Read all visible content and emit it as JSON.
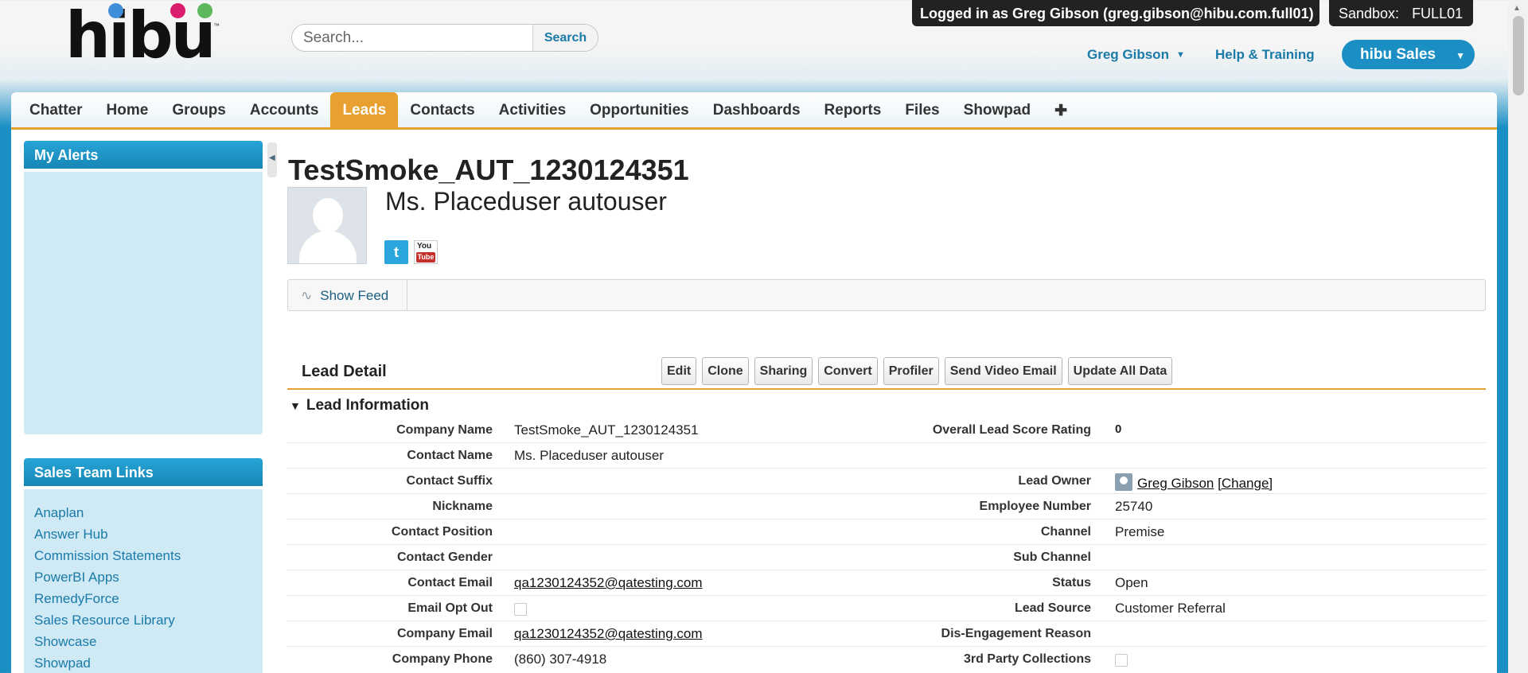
{
  "header": {
    "logo_text": "hibu",
    "logo_tm": "™",
    "search_placeholder": "Search...",
    "search_button": "Search",
    "login_badge": "Logged in as Greg Gibson (greg.gibson@hibu.com.full01)",
    "sandbox_label": "Sandbox:",
    "sandbox_value": "FULL01",
    "user_name": "Greg Gibson",
    "help_link": "Help & Training",
    "app_name": "hibu Sales",
    "colors": {
      "brand_blue": "#1b8fc4",
      "logo_dot_blue": "#3e8fd8",
      "logo_dot_pink": "#d91c6b",
      "logo_dot_green": "#5cb85c",
      "active_tab": "#e8a031"
    }
  },
  "tabs": [
    {
      "label": "Chatter",
      "active": false
    },
    {
      "label": "Home",
      "active": false
    },
    {
      "label": "Groups",
      "active": false
    },
    {
      "label": "Accounts",
      "active": false
    },
    {
      "label": "Leads",
      "active": true
    },
    {
      "label": "Contacts",
      "active": false
    },
    {
      "label": "Activities",
      "active": false
    },
    {
      "label": "Opportunities",
      "active": false
    },
    {
      "label": "Dashboards",
      "active": false
    },
    {
      "label": "Reports",
      "active": false
    },
    {
      "label": "Files",
      "active": false
    },
    {
      "label": "Showpad",
      "active": false
    },
    {
      "label": "✚",
      "active": false
    }
  ],
  "sidebar": {
    "alerts_title": "My Alerts",
    "links_title": "Sales Team Links",
    "links": [
      "Anaplan",
      "Answer Hub",
      "Commission Statements",
      "PowerBI Apps",
      "RemedyForce",
      "Sales Resource Library",
      "Showcase",
      "Showpad"
    ]
  },
  "record": {
    "title": "TestSmoke_AUT_1230124351",
    "contact_name": "Ms. Placeduser autouser",
    "twitter_icon": "t",
    "youtube_you": "You",
    "youtube_tube": "Tube",
    "show_feed": "Show Feed"
  },
  "detail": {
    "title": "Lead Detail",
    "buttons": [
      "Edit",
      "Clone",
      "Sharing",
      "Convert",
      "Profiler",
      "Send Video Email",
      "Update All Data"
    ],
    "section_title": "Lead Information",
    "rows": [
      {
        "l1": "Company Name",
        "v1": "TestSmoke_AUT_1230124351",
        "l2": "Overall Lead Score Rating",
        "v2": "0"
      },
      {
        "l1": "Contact Name",
        "v1": "Ms. Placeduser autouser",
        "l2": "",
        "v2": ""
      },
      {
        "l1": "Contact Suffix",
        "v1": "",
        "l2": "Lead Owner",
        "v2": "Greg Gibson",
        "v2b": "[Change]"
      },
      {
        "l1": "Nickname",
        "v1": "",
        "l2": "Employee Number",
        "v2": "25740"
      },
      {
        "l1": "Contact Position",
        "v1": "",
        "l2": "Channel",
        "v2": "Premise"
      },
      {
        "l1": "Contact Gender",
        "v1": "",
        "l2": "Sub Channel",
        "v2": ""
      },
      {
        "l1": "Contact Email",
        "v1": "qa1230124352@qatesting.com",
        "l2": "Status",
        "v2": "Open"
      },
      {
        "l1": "Email Opt Out",
        "v1": "",
        "l2": "Lead Source",
        "v2": "Customer Referral"
      },
      {
        "l1": "Company Email",
        "v1": "qa1230124352@qatesting.com",
        "l2": "Dis-Engagement Reason",
        "v2": ""
      },
      {
        "l1": "Company Phone",
        "v1": "(860) 307-4918",
        "l2": "3rd Party Collections",
        "v2": ""
      }
    ]
  }
}
